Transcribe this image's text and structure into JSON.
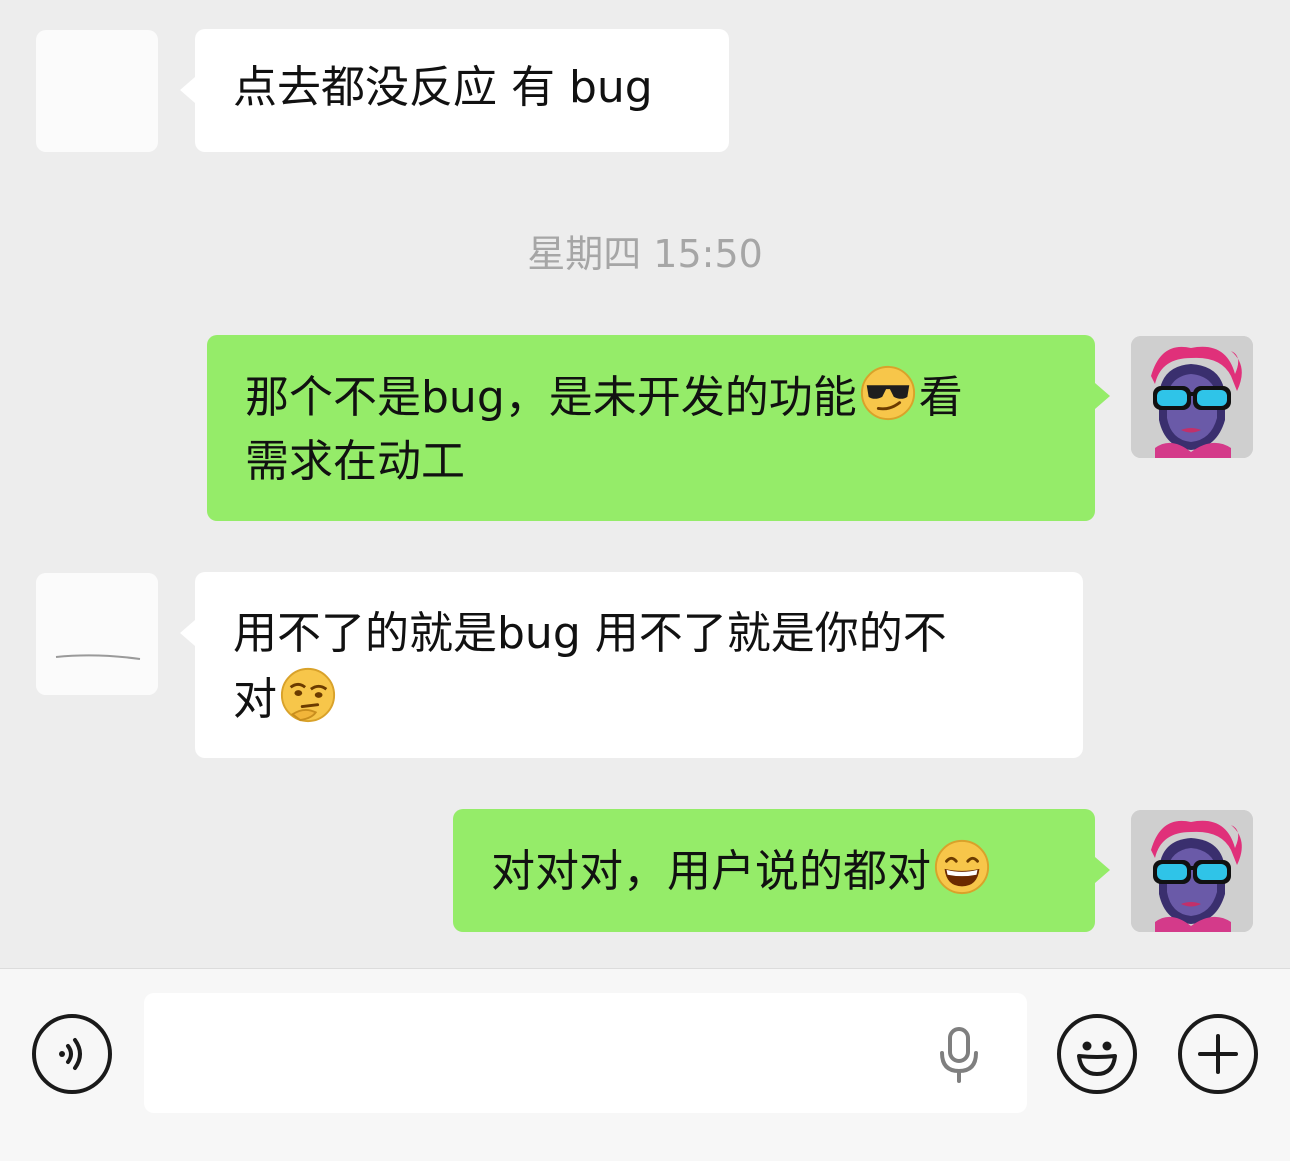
{
  "conversation": {
    "timestamp": "星期四 15:50",
    "messages": [
      {
        "side": "in",
        "text": "点去都没反应 有 bug"
      },
      {
        "side": "out",
        "line1": "那个不是bug，是未开发的功能",
        "line1_after_emoji": "看",
        "line2": "需求在动工",
        "emoji": "smirk-sunglasses-emoji"
      },
      {
        "side": "in",
        "line1": "用不了的就是bug 用不了就是你的不",
        "line2": "对",
        "emoji": "thinking-face-emoji"
      },
      {
        "side": "out",
        "text": "对对对，用户说的都对",
        "emoji": "grinning-face-emoji"
      }
    ]
  },
  "input": {
    "placeholder": "",
    "voice_icon": "voice-icon",
    "mic_icon": "microphone-icon",
    "emoji_icon": "smiley-icon",
    "add_icon": "plus-icon"
  },
  "colors": {
    "background": "#ededed",
    "outgoing_bubble": "#95ec69",
    "incoming_bubble": "#ffffff",
    "timestamp": "#a6a6a6"
  }
}
